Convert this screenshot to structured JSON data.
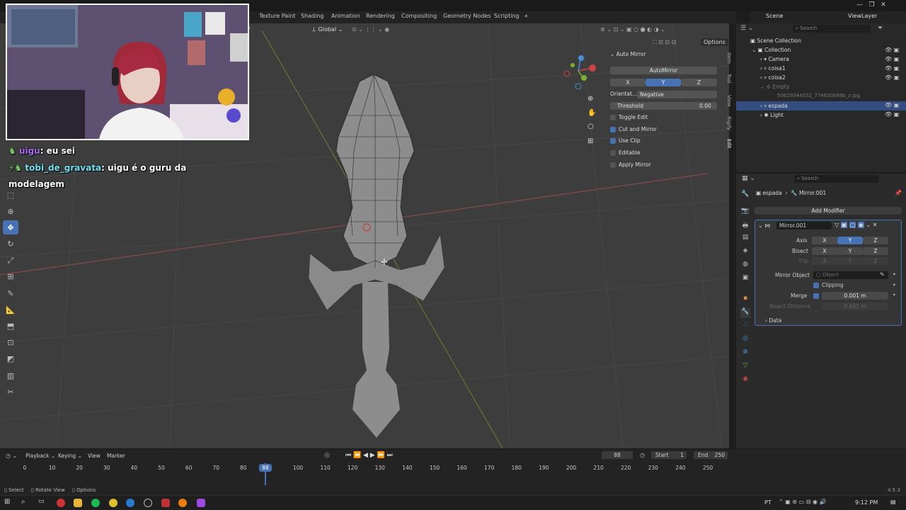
{
  "workspace_tabs": [
    "Texture Paint",
    "Shading",
    "Animation",
    "Rendering",
    "Compositing",
    "Geometry Nodes",
    "Scripting",
    "+"
  ],
  "top_right": {
    "scene": "Scene",
    "view_layer": "ViewLayer"
  },
  "viewport": {
    "orientation": "Global",
    "options_label": "Options",
    "view_menu_fragment": "V"
  },
  "auto_mirror": {
    "header": "Auto Mirror",
    "run_button": "AutoMirror",
    "axes": [
      "X",
      "Y",
      "Z"
    ],
    "selected_axis": "Y",
    "orientation_label": "Orientat...",
    "orientation_value": "Negative",
    "threshold_label": "Threshold",
    "threshold_value": "0.00",
    "toggle_edit": "Toggle Edit",
    "cut_and_mirror": "Cut and Mirror",
    "use_clip": "Use Clip",
    "editable": "Editable",
    "apply_mirror": "Apply Mirror"
  },
  "side_tabs": [
    "Item",
    "Tool",
    "View",
    "Rigify",
    "Edit"
  ],
  "outliner": {
    "search_placeholder": "Search",
    "rows": [
      {
        "label": "Scene Collection",
        "indent": 0
      },
      {
        "label": "Collection",
        "indent": 1
      },
      {
        "label": "Camera",
        "indent": 2
      },
      {
        "label": "coisa1",
        "indent": 2
      },
      {
        "label": "coisa2",
        "indent": 2
      },
      {
        "label": "Empty",
        "indent": 2
      },
      {
        "label": "50629344552_77e830b98b_z.jpg",
        "indent": 3
      },
      {
        "label": "espada",
        "indent": 2
      },
      {
        "label": "Light",
        "indent": 2
      }
    ]
  },
  "properties": {
    "search_placeholder": "Search",
    "breadcrumb_object": "espada",
    "breadcrumb_modifier": "Mirror.001",
    "add_modifier": "Add Modifier",
    "modifier_name": "Mirror.001",
    "axis_label": "Axis",
    "bisect_label": "Bisect",
    "flip_label": "Flip",
    "xyz": [
      "X",
      "Y",
      "Z"
    ],
    "mirror_object_label": "Mirror Object",
    "mirror_object_placeholder": "Object",
    "clipping_label": "Clipping",
    "merge_label": "Merge",
    "merge_value": "0.001 m",
    "bisect_distance_label": "Bisect Distance",
    "bisect_distance_value": "0.001 m",
    "data_label": "Data"
  },
  "timeline": {
    "menus": [
      "Playback",
      "Keying",
      "View",
      "Marker"
    ],
    "current_frame": "88",
    "start_label": "Start",
    "start_value": "1",
    "end_label": "End",
    "end_value": "250",
    "ticks": [
      "0",
      "10",
      "20",
      "30",
      "40",
      "50",
      "60",
      "70",
      "80",
      "",
      "100",
      "110",
      "120",
      "130",
      "140",
      "150",
      "160",
      "170",
      "180",
      "190",
      "200",
      "210",
      "220",
      "230",
      "240",
      "250"
    ],
    "playhead": "88"
  },
  "statusbar": {
    "select": "Select",
    "rotate": "Rotate View",
    "options": "Options",
    "version": "4.5.3"
  },
  "taskbar": {
    "lang": "PT",
    "time": "9:12 PM"
  },
  "chat": {
    "line1_user": "uigu",
    "line1_text": ": eu sei",
    "line2_user": "tobi_de_gravata",
    "line2_text": "uigu é o guru da",
    "line3_text": "modelagem"
  },
  "colors": {
    "accent": "#4772b3",
    "viewport": "#3d3d3d",
    "chat_user1": "#a86cf0",
    "chat_user2": "#6fe0f0"
  }
}
